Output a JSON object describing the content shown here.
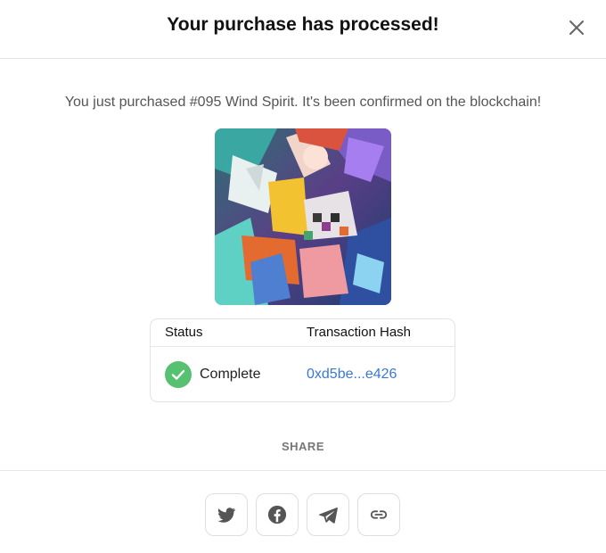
{
  "modal": {
    "title": "Your purchase has processed!",
    "message": "You just purchased #095 Wind Spirit. It's been confirmed on the blockchain!"
  },
  "details": {
    "status_header": "Status",
    "hash_header": "Transaction Hash",
    "status_value": "Complete",
    "hash_value": "0xd5be...e426"
  },
  "share": {
    "label": "SHARE",
    "buttons": [
      "twitter-icon",
      "facebook-icon",
      "telegram-icon",
      "link-icon"
    ]
  },
  "colors": {
    "success": "#56c271",
    "link": "#3a78d4",
    "icon": "#555555"
  }
}
